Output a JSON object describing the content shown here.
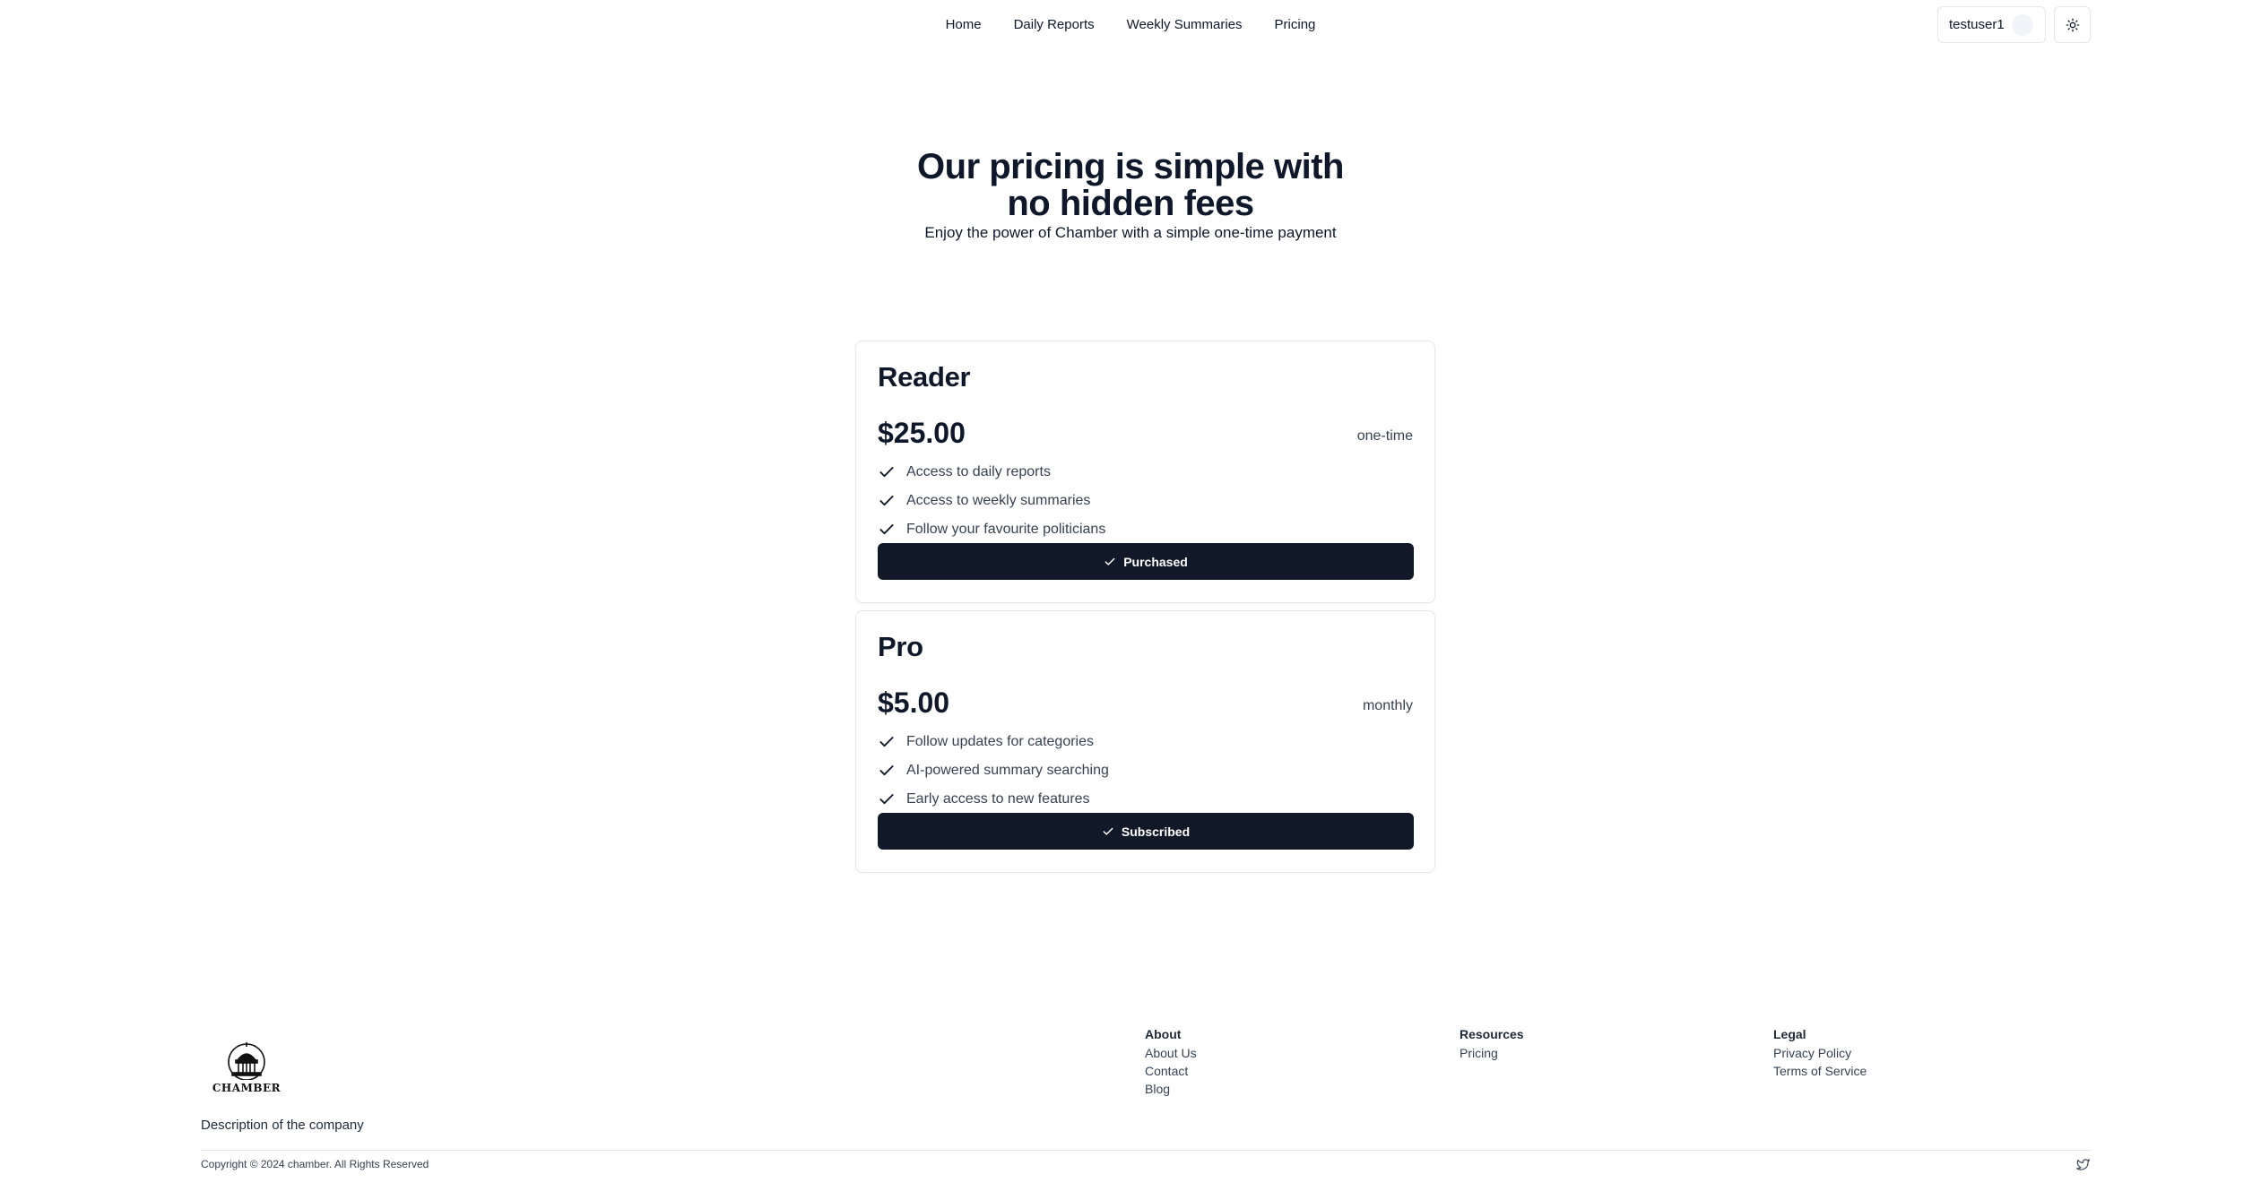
{
  "nav": {
    "links": [
      "Home",
      "Daily Reports",
      "Weekly Summaries",
      "Pricing"
    ],
    "username": "testuser1"
  },
  "hero": {
    "title": "Our pricing is simple with no hidden fees",
    "subtitle": "Enjoy the power of Chamber with a simple one-time payment"
  },
  "plans": [
    {
      "name": "Reader",
      "price": "$25.00",
      "period": "one-time",
      "features": [
        "Access to daily reports",
        "Access to weekly summaries",
        "Follow your favourite politicians"
      ],
      "button": "Purchased"
    },
    {
      "name": "Pro",
      "price": "$5.00",
      "period": "monthly",
      "features": [
        "Follow updates for categories",
        "AI-powered summary searching",
        "Early access to new features"
      ],
      "button": "Subscribed"
    }
  ],
  "footer": {
    "logo_text": "CHAMBER",
    "description": "Description of the company",
    "columns": [
      {
        "title": "About",
        "links": [
          "About Us",
          "Contact",
          "Blog"
        ]
      },
      {
        "title": "Resources",
        "links": [
          "Pricing"
        ]
      },
      {
        "title": "Legal",
        "links": [
          "Privacy Policy",
          "Terms of Service"
        ]
      }
    ],
    "copyright": "Copyright © 2024 chamber. All Rights Reserved"
  },
  "colors": {
    "button_bg": "#111827",
    "text": "#0f172a",
    "border": "#e5e7eb"
  },
  "icons": {
    "theme": "sun-icon",
    "feature": "check-icon",
    "social": "twitter-icon"
  }
}
